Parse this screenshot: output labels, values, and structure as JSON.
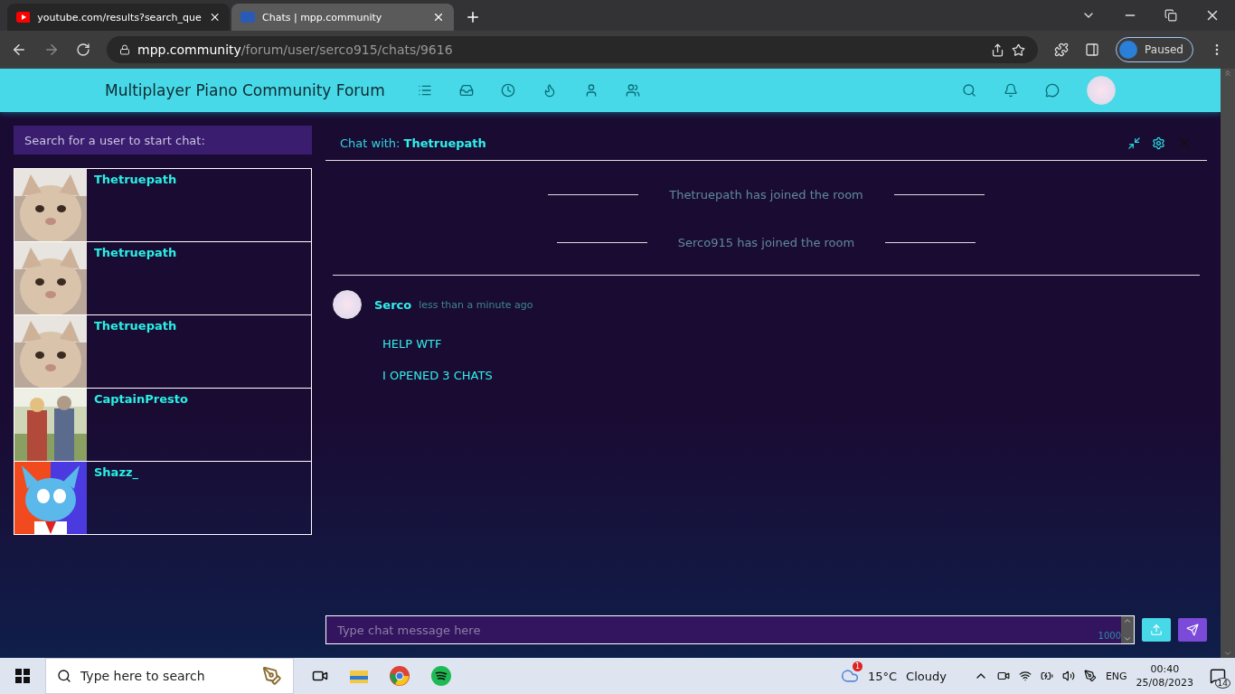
{
  "browser": {
    "tabs": [
      {
        "title": "youtube.com/results?search_que",
        "kind": "video",
        "selected": false
      },
      {
        "title": "Chats | mpp.community",
        "kind": "forum",
        "selected": true
      }
    ],
    "address": {
      "host": "mpp.community",
      "path": "/forum/user/serco915/chats/9616"
    },
    "profile": {
      "label": "Paused"
    }
  },
  "site": {
    "title": "Multiplayer Piano Community Forum"
  },
  "sidebar": {
    "search": {
      "placeholder": "Search for a user to start chat:"
    },
    "chats": [
      {
        "name": "Thetruepath"
      },
      {
        "name": "Thetruepath"
      },
      {
        "name": "Thetruepath"
      },
      {
        "name": "CaptainPresto"
      },
      {
        "name": "Shazz_"
      }
    ]
  },
  "chat": {
    "title": "Chat with: **Thetruepath**",
    "events": [
      "Thetruepath has joined the room",
      "Serco915 has joined the room"
    ],
    "messages": [
      {
        "author": "Serco",
        "time": "less than a minute ago",
        "lines": [
          "HELP WTF",
          "I OPENED 3 CHATS"
        ]
      }
    ],
    "composer": {
      "placeholder": "Type chat message here",
      "counter": "1000"
    }
  },
  "taskbar": {
    "search": {
      "placeholder": "Type here to search"
    },
    "weather": {
      "badge": "1",
      "temperature": "15°C",
      "condition": "Cloudy"
    },
    "language": "ENG",
    "time": "00:40",
    "date": "25/08/2023",
    "notifications": "14"
  }
}
